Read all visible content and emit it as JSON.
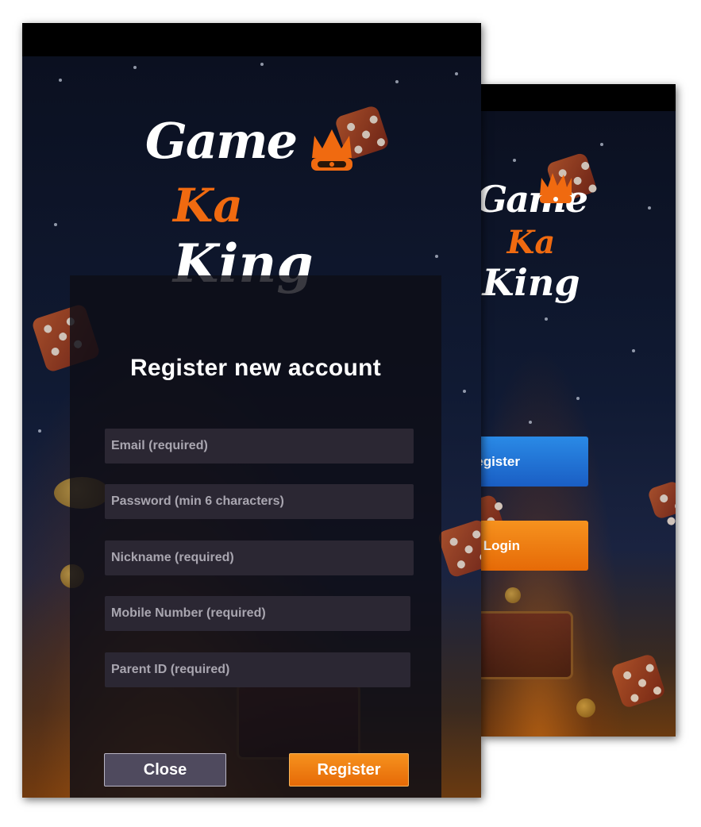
{
  "back_screen": {
    "logo_game": "Game",
    "logo_ka": "Ka",
    "logo_king": "King",
    "register_label": "Register",
    "login_label": "Login"
  },
  "front_screen": {
    "logo_game": "Game",
    "logo_ka": "Ka",
    "logo_king": "King",
    "form": {
      "title": "Register new account",
      "email_placeholder": "Email (required)",
      "password_placeholder": "Password (min 6 characters)",
      "nickname_placeholder": "Nickname (required)",
      "mobile_placeholder": "Mobile Number (required)",
      "parent_id_placeholder": "Parent ID (required)",
      "close_label": "Close",
      "register_label": "Register"
    }
  },
  "colors": {
    "accent_orange": "#f06a10",
    "register_blue": "#1a5ec4",
    "panel_bg": "#0e0e16",
    "field_bg": "#2b2733"
  }
}
